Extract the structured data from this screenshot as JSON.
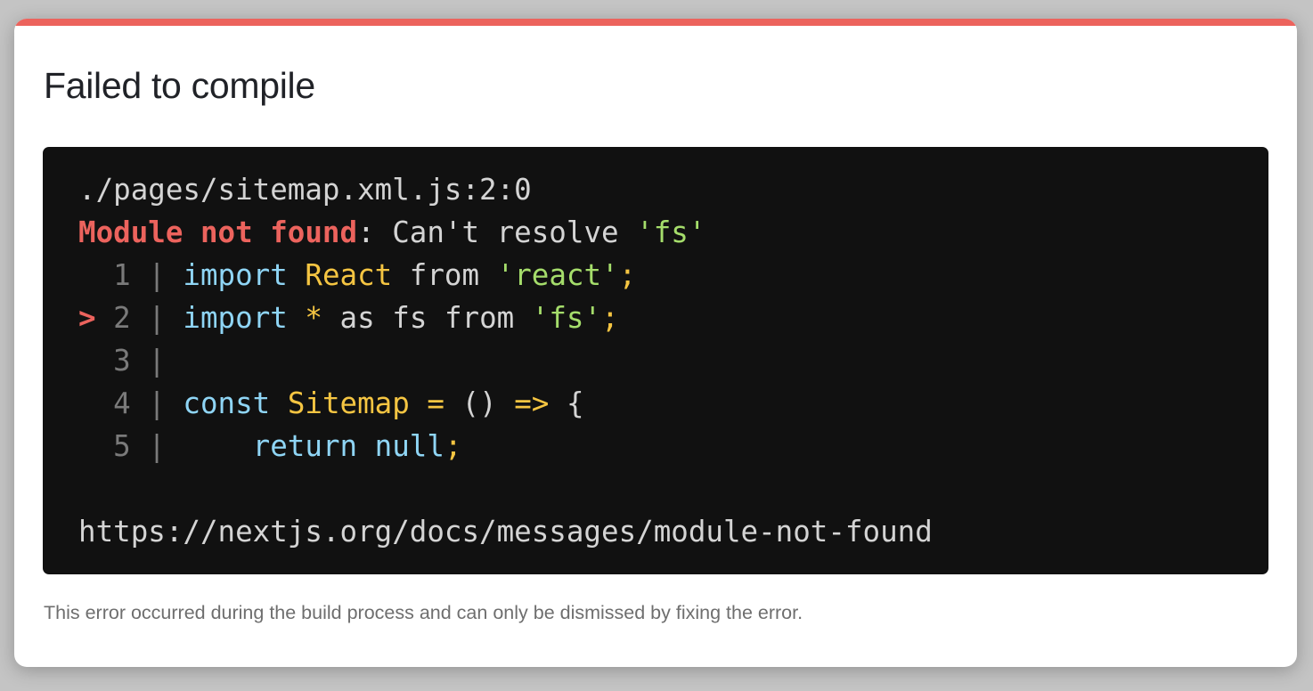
{
  "colors": {
    "accent": "#ec635d",
    "code_bg": "#111111",
    "default": "#d4d4d4",
    "error": "#ec635d",
    "keyword": "#8fd5f5",
    "identifier": "#f5c542",
    "string": "#a5dd6b",
    "gutter": "#7a7a7a"
  },
  "dialog": {
    "title": "Failed to compile",
    "code_lines": [
      [
        {
          "t": "./pages/sitemap.xml.js:2:0",
          "c": "default"
        }
      ],
      [
        {
          "t": "Module not found",
          "c": "error",
          "b": true
        },
        {
          "t": ": Can't resolve ",
          "c": "default"
        },
        {
          "t": "'fs'",
          "c": "string"
        }
      ],
      [
        {
          "t": "  1 | ",
          "c": "gutter"
        },
        {
          "t": "import",
          "c": "keyword"
        },
        {
          "t": " ",
          "c": "default"
        },
        {
          "t": "React",
          "c": "identifier"
        },
        {
          "t": " from ",
          "c": "default"
        },
        {
          "t": "'react'",
          "c": "string"
        },
        {
          "t": ";",
          "c": "identifier"
        }
      ],
      [
        {
          "t": ">",
          "c": "error",
          "b": true
        },
        {
          "t": " 2 | ",
          "c": "gutter"
        },
        {
          "t": "import",
          "c": "keyword"
        },
        {
          "t": " ",
          "c": "default"
        },
        {
          "t": "*",
          "c": "identifier"
        },
        {
          "t": " as fs from ",
          "c": "default"
        },
        {
          "t": "'fs'",
          "c": "string"
        },
        {
          "t": ";",
          "c": "identifier"
        }
      ],
      [
        {
          "t": "  3 |",
          "c": "gutter"
        }
      ],
      [
        {
          "t": "  4 | ",
          "c": "gutter"
        },
        {
          "t": "const",
          "c": "keyword"
        },
        {
          "t": " ",
          "c": "default"
        },
        {
          "t": "Sitemap",
          "c": "identifier"
        },
        {
          "t": " ",
          "c": "default"
        },
        {
          "t": "=",
          "c": "identifier"
        },
        {
          "t": " () ",
          "c": "default"
        },
        {
          "t": "=>",
          "c": "identifier"
        },
        {
          "t": " {",
          "c": "default"
        }
      ],
      [
        {
          "t": "  5 | ",
          "c": "gutter"
        },
        {
          "t": "    return",
          "c": "keyword"
        },
        {
          "t": " ",
          "c": "default"
        },
        {
          "t": "null",
          "c": "keyword"
        },
        {
          "t": ";",
          "c": "identifier"
        }
      ],
      [],
      [
        {
          "t": "https://nextjs.org/docs/messages/module-not-found",
          "c": "default"
        }
      ]
    ],
    "footer": "This error occurred during the build process and can only be dismissed by fixing the error."
  }
}
